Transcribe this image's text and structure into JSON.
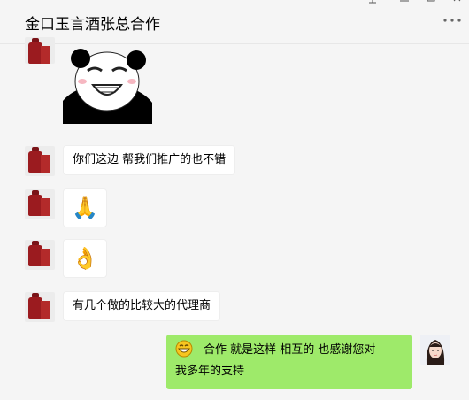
{
  "header": {
    "title": "金口玉言酒张总合作",
    "more_icon": "more-horizontal-icon",
    "window_controls": [
      "pin-icon",
      "minimize-icon",
      "maximize-icon",
      "close-icon"
    ]
  },
  "messages": [
    {
      "sender": "other",
      "type": "sticker",
      "sticker": "panda-meme-face"
    },
    {
      "sender": "other",
      "type": "text",
      "text": "你们这边 帮我们推广的也不错"
    },
    {
      "sender": "other",
      "type": "emoji",
      "emoji": "🙏"
    },
    {
      "sender": "other",
      "type": "emoji",
      "emoji": "👌"
    },
    {
      "sender": "other",
      "type": "text",
      "text": "有几个做的比较大的代理商"
    },
    {
      "sender": "me",
      "type": "text",
      "emoji": "grinning-face",
      "text_line1": "合作 就是这样  相互的   也感谢您对",
      "text_line2": "我多年的支持"
    }
  ],
  "colors": {
    "background": "#f5f5f5",
    "my_bubble": "#9eea6a",
    "other_bubble": "#ffffff"
  }
}
